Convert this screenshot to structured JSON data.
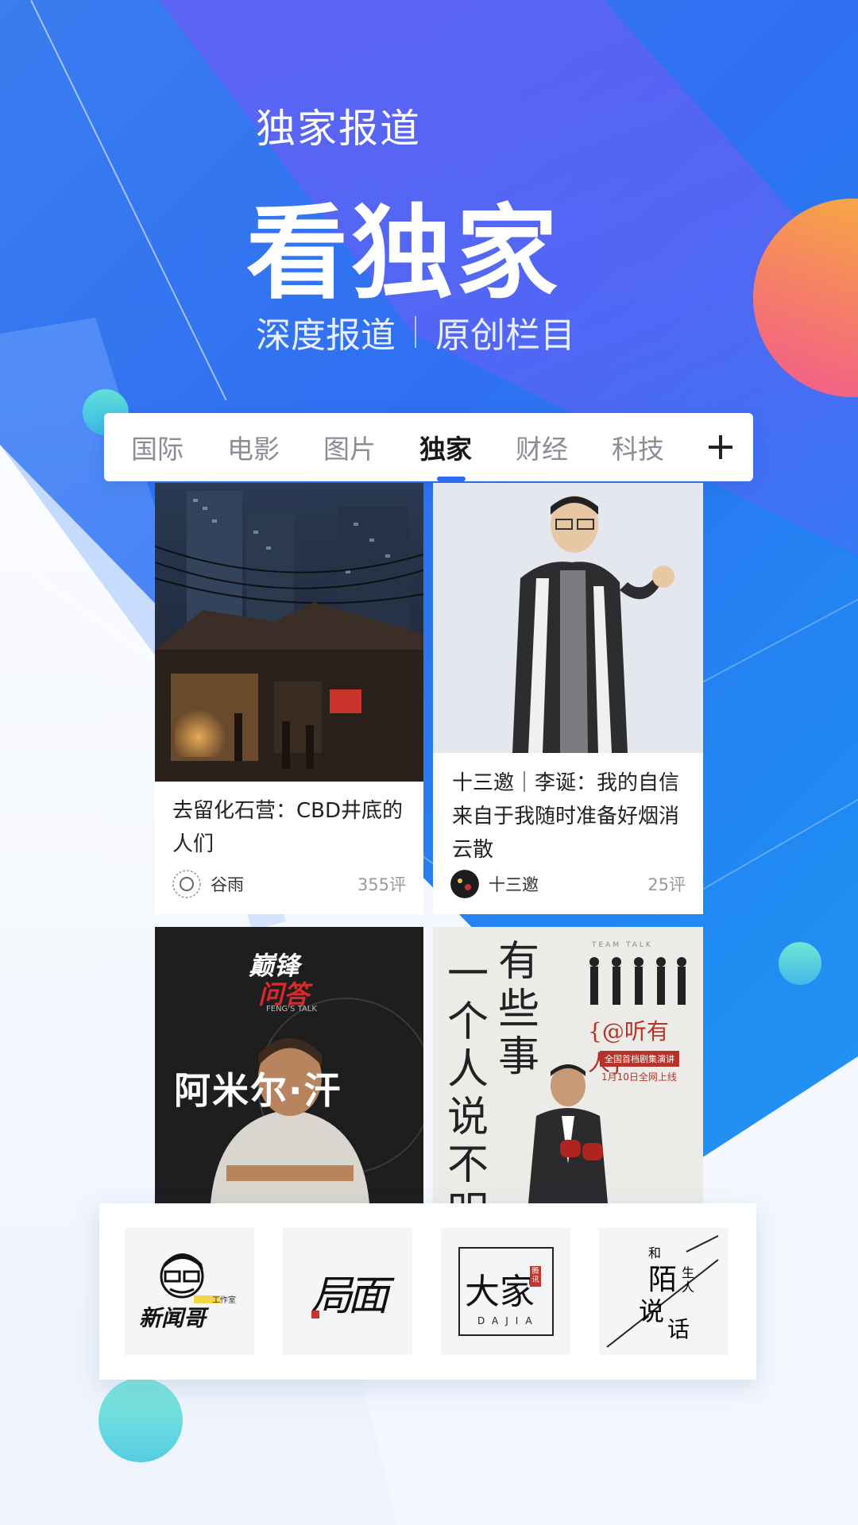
{
  "hero": {
    "eyebrow": "独家报道",
    "title": "看独家",
    "subtitle_left": "深度报道",
    "subtitle_right": "原创栏目"
  },
  "tabs": [
    {
      "label": "国际",
      "active": false
    },
    {
      "label": "电影",
      "active": false
    },
    {
      "label": "图片",
      "active": false
    },
    {
      "label": "独家",
      "active": true
    },
    {
      "label": "财经",
      "active": false
    },
    {
      "label": "科技",
      "active": false
    }
  ],
  "add_tab_icon": "plus-icon",
  "cards": [
    {
      "title": "去留化石营：CBD井底的\n人们",
      "author": "谷雨",
      "comments": "355评"
    },
    {
      "title": "十三邀｜李诞：我的自信\n来自于我随时准备好烟消\n云散",
      "author": "十三邀",
      "comments": "25评"
    },
    {
      "poster_brand": "巅锋",
      "poster_brand2": "问答",
      "poster_small": "FENG'S TALK",
      "poster_name": "阿米尔·汗"
    },
    {
      "poster_vertical_1": "一个人说不明",
      "poster_vertical_2": "有些事",
      "poster_handle": "{@听有人}",
      "poster_tag": "全国首档剧集演讲",
      "poster_date": "1月10日全网上线",
      "poster_eng": "TEAM TALK"
    }
  ],
  "columns": [
    {
      "name": "新闻哥",
      "sub": "工作室"
    },
    {
      "name": "局面"
    },
    {
      "name": "大家",
      "sub": "DAJIA",
      "badge": "腾讯"
    },
    {
      "name": "和陌生人说话",
      "top": "和",
      "mid": "陌",
      "right": "生人",
      "bottom": "说",
      "bottom2": "话"
    }
  ],
  "colors": {
    "accent": "#2d6cf2",
    "orb_orange": "#f67e68",
    "teal": "#45c6e0"
  }
}
